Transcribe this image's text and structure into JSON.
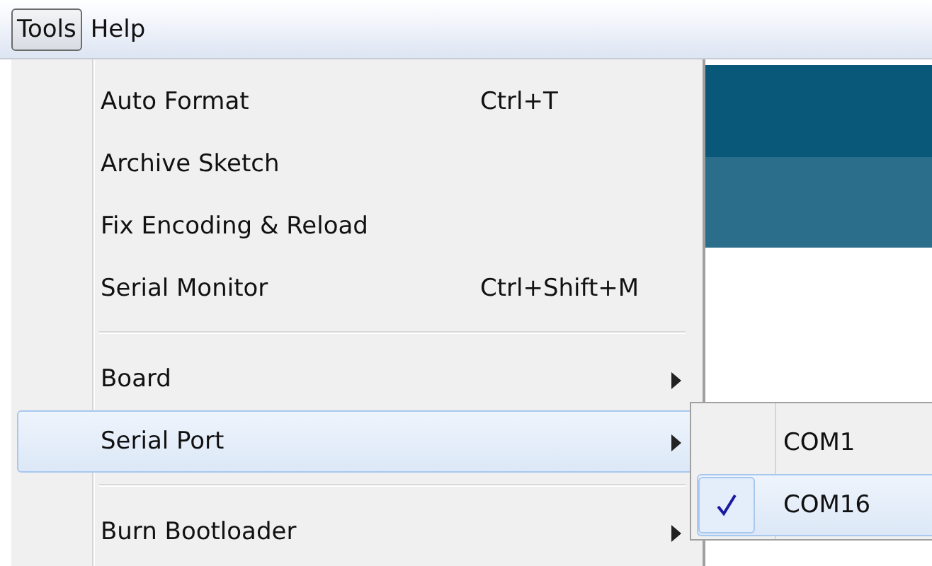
{
  "menubar": [
    {
      "label": "Tools",
      "selected": true
    },
    {
      "label": "Help",
      "selected": false
    }
  ],
  "menu": [
    {
      "kind": "item",
      "label": "Auto Format",
      "shortcut": "Ctrl+T",
      "submenu": false,
      "selected": false
    },
    {
      "kind": "item",
      "label": "Archive Sketch",
      "submenu": false,
      "selected": false
    },
    {
      "kind": "item",
      "label": "Fix Encoding & Reload",
      "submenu": false,
      "selected": false
    },
    {
      "kind": "item",
      "label": "Serial Monitor",
      "shortcut": "Ctrl+Shift+M",
      "submenu": false,
      "selected": false
    },
    {
      "kind": "separator"
    },
    {
      "kind": "item",
      "label": "Board",
      "submenu": true,
      "selected": false
    },
    {
      "kind": "item",
      "label": "Serial Port",
      "submenu": true,
      "selected": true
    },
    {
      "kind": "separator"
    },
    {
      "kind": "item",
      "label": "Burn Bootloader",
      "submenu": true,
      "selected": false
    }
  ],
  "submenu": [
    {
      "label": "COM1",
      "checked": false,
      "selected": false
    },
    {
      "label": "COM16",
      "checked": true,
      "selected": true
    }
  ]
}
